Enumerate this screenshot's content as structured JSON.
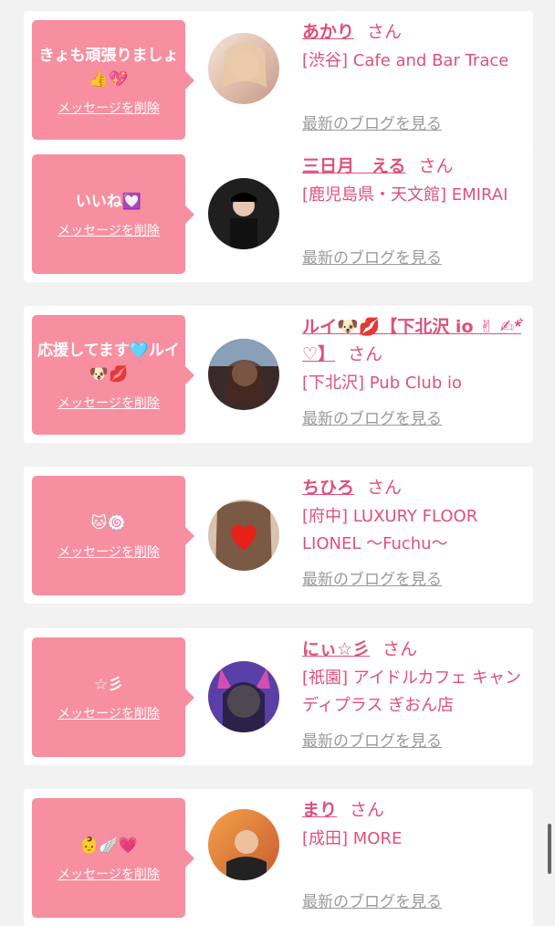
{
  "cards": [
    {
      "message": "きょも頑張りましょ👍💖",
      "delete_label": "メッセージを削除",
      "name": "あかり",
      "san": "さん",
      "shop": "[渋谷] Cafe and Bar Trace",
      "blog_label": "最新のブログを見る",
      "avatar_colors": [
        "#f6e4d8",
        "#c89a86"
      ]
    },
    {
      "message": "いいね💟",
      "delete_label": "メッセージを削除",
      "name": "三日月　える",
      "san": "さん",
      "shop": "[鹿児島県・天文館] EMIRAI",
      "blog_label": "最新のブログを見る",
      "avatar_colors": [
        "#1f1f1f",
        "#6b4a3a"
      ]
    },
    {
      "message": "応援してます🩵ルイ🐶💋",
      "delete_label": "メッセージを削除",
      "name": "ルイ🐶💋【下北沢 io ✌︎ ✍︎*͛ ♡】",
      "san": "さん",
      "shop": "[下北沢] Pub Club io",
      "blog_label": "最新のブログを見る",
      "avatar_colors": [
        "#3a2a2a",
        "#c98a6a"
      ]
    },
    {
      "message": "🐱🍥",
      "delete_label": "メッセージを削除",
      "name": "ちひろ",
      "san": "さん",
      "shop": "[府中] LUXURY FLOOR LIONEL 〜Fuchu〜",
      "blog_label": "最新のブログを見る",
      "avatar_colors": [
        "#d9c2ae",
        "#7a5a44"
      ]
    },
    {
      "message": "☆彡",
      "delete_label": "メッセージを削除",
      "name": "にぃ☆彡",
      "san": "さん",
      "shop": "[祇園] アイドルカフェ キャンディプラス ぎおん店",
      "blog_label": "最新のブログを見る",
      "avatar_colors": [
        "#5b3fa8",
        "#222233"
      ]
    },
    {
      "message": "👶🪽💗",
      "delete_label": "メッセージを削除",
      "name": "まり",
      "san": "さん",
      "shop": "[成田] MORE",
      "blog_label": "最新のブログを見る",
      "avatar_colors": [
        "#f4a24a",
        "#6b4a3a"
      ]
    }
  ]
}
